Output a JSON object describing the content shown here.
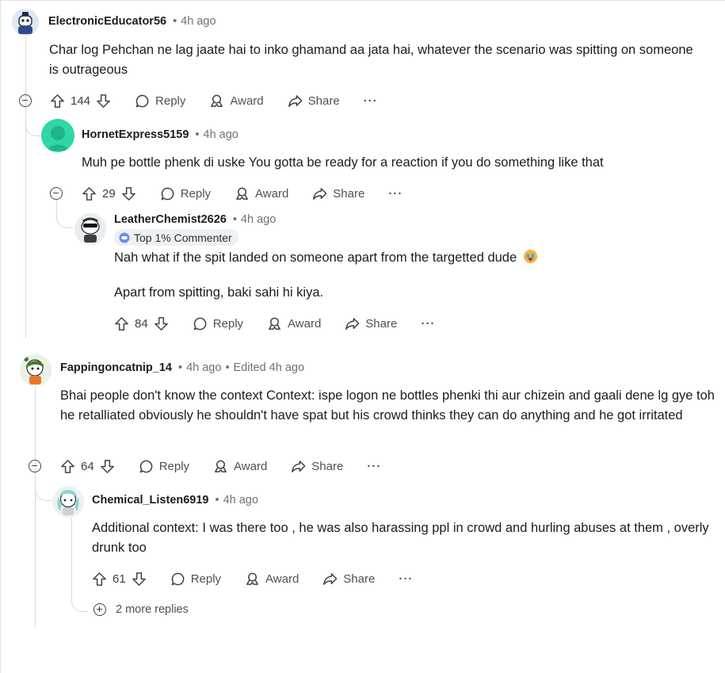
{
  "comments": [
    {
      "username": "ElectronicEducator56",
      "time": "4h ago",
      "text": "Char log Pehchan ne lag jaate hai to inko ghamand aa jata hai, whatever the scenario was spitting on someone is outrageous",
      "votes": "144",
      "reply": "Reply",
      "award": "Award",
      "share": "Share",
      "more": "···"
    },
    {
      "username": "HornetExpress5159",
      "time": "4h ago",
      "text": "Muh pe bottle phenk di uske You gotta be ready for a reaction if you do something like that",
      "votes": "29",
      "reply": "Reply",
      "award": "Award",
      "share": "Share",
      "more": "···"
    },
    {
      "username": "LeatherChemist2626",
      "time": "4h ago",
      "badge": "Top 1% Commenter",
      "text1": "Nah what if the spit landed on someone apart from the targetted dude",
      "text2": "Apart from spitting, baki sahi hi kiya.",
      "votes": "84",
      "reply": "Reply",
      "award": "Award",
      "share": "Share",
      "more": "···"
    },
    {
      "username": "Fappingoncatnip_14",
      "time": "4h ago",
      "edited": "Edited 4h ago",
      "text": "Bhai people don't know the context Context: ispe logon ne bottles phenki thi aur chizein and gaali dene lg gye toh he retalliated obviously he shouldn't have spat but his crowd thinks they can do anything and he got irritated",
      "votes": "64",
      "reply": "Reply",
      "award": "Award",
      "share": "Share",
      "more": "···"
    },
    {
      "username": "Chemical_Listen6919",
      "time": "4h ago",
      "text": "Additional context: I was there too , he was also harassing ppl in crowd and hurling abuses at them , overly drunk too",
      "votes": "61",
      "reply": "Reply",
      "award": "Award",
      "share": "Share",
      "more": "···"
    }
  ],
  "more_replies": "2 more replies",
  "icons": {
    "upvote": "arrow-up-icon",
    "downvote": "arrow-down-icon",
    "reply": "speech-bubble-icon",
    "award": "award-icon",
    "share": "share-arrow-icon",
    "collapse": "minus-circle-icon",
    "expand": "plus-circle-icon"
  },
  "colors": {
    "text": "#1c1c1c",
    "meta": "#6b7276",
    "thread_line": "#d6dadc",
    "hornet_avatar": "#2fd6a6"
  }
}
